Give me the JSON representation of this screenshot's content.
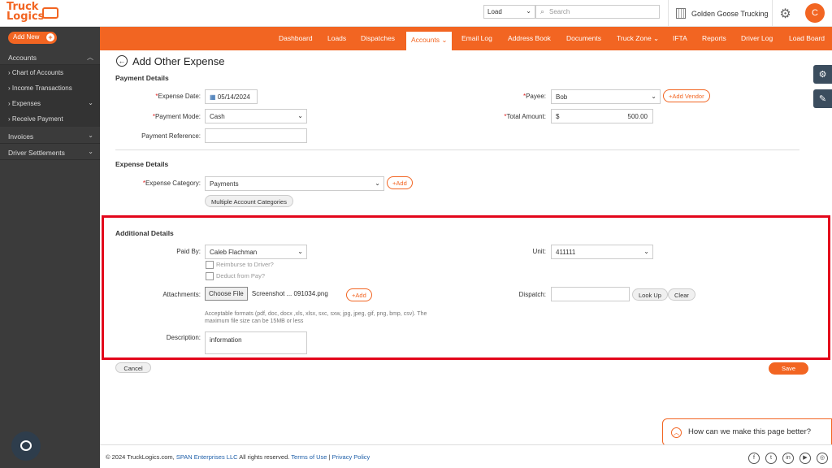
{
  "brand": {
    "logo_line1": "Truck",
    "logo_line2": "Logics",
    "accent": "#f26522"
  },
  "topbar": {
    "search_type": "Load",
    "search_placeholder": "Search",
    "company": "Golden Goose Trucking",
    "avatar_initial": "C"
  },
  "sidebar": {
    "add_new": "Add New",
    "accounts": "Accounts",
    "items": [
      "Chart of Accounts",
      "Income Transactions",
      "Expenses",
      "Receive Payment"
    ],
    "invoices": "Invoices",
    "driver_settlements": "Driver Settlements"
  },
  "nav": {
    "items": [
      "Dashboard",
      "Loads",
      "Dispatches",
      "Accounts",
      "Email Log",
      "Address Book",
      "Documents",
      "Truck Zone",
      "IFTA",
      "Reports",
      "Driver Log",
      "Load Board"
    ],
    "active": "Accounts"
  },
  "page": {
    "title": "Add Other Expense"
  },
  "payment_details": {
    "title": "Payment Details",
    "expense_date_label": "Expense Date:",
    "expense_date": "05/14/2024",
    "payee_label": "Payee:",
    "payee": "Bob",
    "add_vendor": "Add Vendor",
    "payment_mode_label": "Payment Mode:",
    "payment_mode": "Cash",
    "total_amount_label": "Total Amount:",
    "currency": "$",
    "total_amount": "500.00",
    "payment_reference_label": "Payment Reference:",
    "payment_reference": ""
  },
  "expense_details": {
    "title": "Expense Details",
    "category_label": "Expense Category:",
    "category": "Payments",
    "add": "Add",
    "multiple": "Multiple Account Categories"
  },
  "additional_details": {
    "title": "Additional Details",
    "paid_by_label": "Paid By:",
    "paid_by": "Caleb Flachman",
    "reimburse": "Reimburse to Driver?",
    "deduct": "Deduct from Pay?",
    "unit_label": "Unit:",
    "unit": "411111",
    "attachments_label": "Attachments:",
    "choose_file": "Choose File",
    "file_name": "Screenshot ... 091034.png",
    "add": "Add",
    "formats_hint_1": "Acceptable formats (pdf, doc, docx ,xls, xlsx, sxc, sxw, jpg, jpeg, gif, png, bmp, csv). The",
    "formats_hint_2": "maximum file size can be 15MB or less",
    "dispatch_label": "Dispatch:",
    "dispatch": "",
    "lookup": "Look Up",
    "clear": "Clear",
    "description_label": "Description:",
    "description": "information"
  },
  "actions": {
    "cancel": "Cancel",
    "save": "Save"
  },
  "footer": {
    "copyright": "© 2024 TruckLogics.com,",
    "company_link": "SPAN Enterprises LLC",
    "rights": "All rights reserved.",
    "terms": "Terms of Use",
    "sep": "|",
    "privacy": "Privacy Policy"
  },
  "feedback": {
    "label": "How can we make this page better?"
  }
}
